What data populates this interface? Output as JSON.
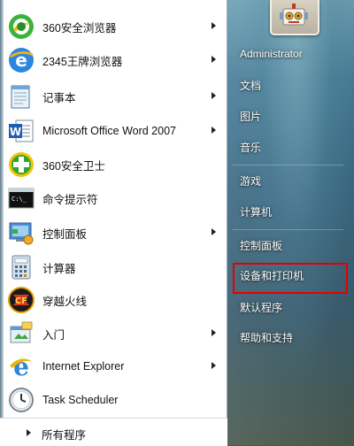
{
  "start_menu": {
    "programs": [
      {
        "label": "360安全浏览器",
        "icon": "360-browser-icon",
        "has_submenu": true
      },
      {
        "label": "2345王牌浏览器",
        "icon": "2345-browser-icon",
        "has_submenu": true
      },
      {
        "label": "记事本",
        "icon": "notepad-icon",
        "has_submenu": true
      },
      {
        "label": "Microsoft Office Word 2007",
        "icon": "word-icon",
        "has_submenu": true
      },
      {
        "label": "360安全卫士",
        "icon": "360-safe-guard-icon",
        "has_submenu": false
      },
      {
        "label": "命令提示符",
        "icon": "cmd-icon",
        "has_submenu": false
      },
      {
        "label": "控制面板",
        "icon": "control-panel-icon",
        "has_submenu": true
      },
      {
        "label": "计算器",
        "icon": "calculator-icon",
        "has_submenu": false
      },
      {
        "label": "穿越火线",
        "icon": "crossfire-icon",
        "has_submenu": false
      },
      {
        "label": "入门",
        "icon": "getting-started-icon",
        "has_submenu": true
      },
      {
        "label": "Internet Explorer",
        "icon": "internet-explorer-icon",
        "has_submenu": true
      },
      {
        "label": "Task Scheduler",
        "icon": "task-scheduler-icon",
        "has_submenu": false
      }
    ],
    "all_programs": "所有程序",
    "right_items": [
      {
        "label": "Administrator",
        "selected": false
      },
      {
        "label": "文档",
        "selected": false
      },
      {
        "label": "图片",
        "selected": false
      },
      {
        "label": "音乐",
        "selected": false
      },
      {
        "label": "游戏",
        "selected": false
      },
      {
        "label": "计算机",
        "selected": false
      },
      {
        "label": "控制面板",
        "selected": false
      },
      {
        "label": "设备和打印机",
        "selected": true
      },
      {
        "label": "默认程序",
        "selected": false
      },
      {
        "label": "帮助和支持",
        "selected": false
      }
    ],
    "user_avatar_icon": "robot-avatar-icon",
    "highlight_color": "#e40000"
  }
}
